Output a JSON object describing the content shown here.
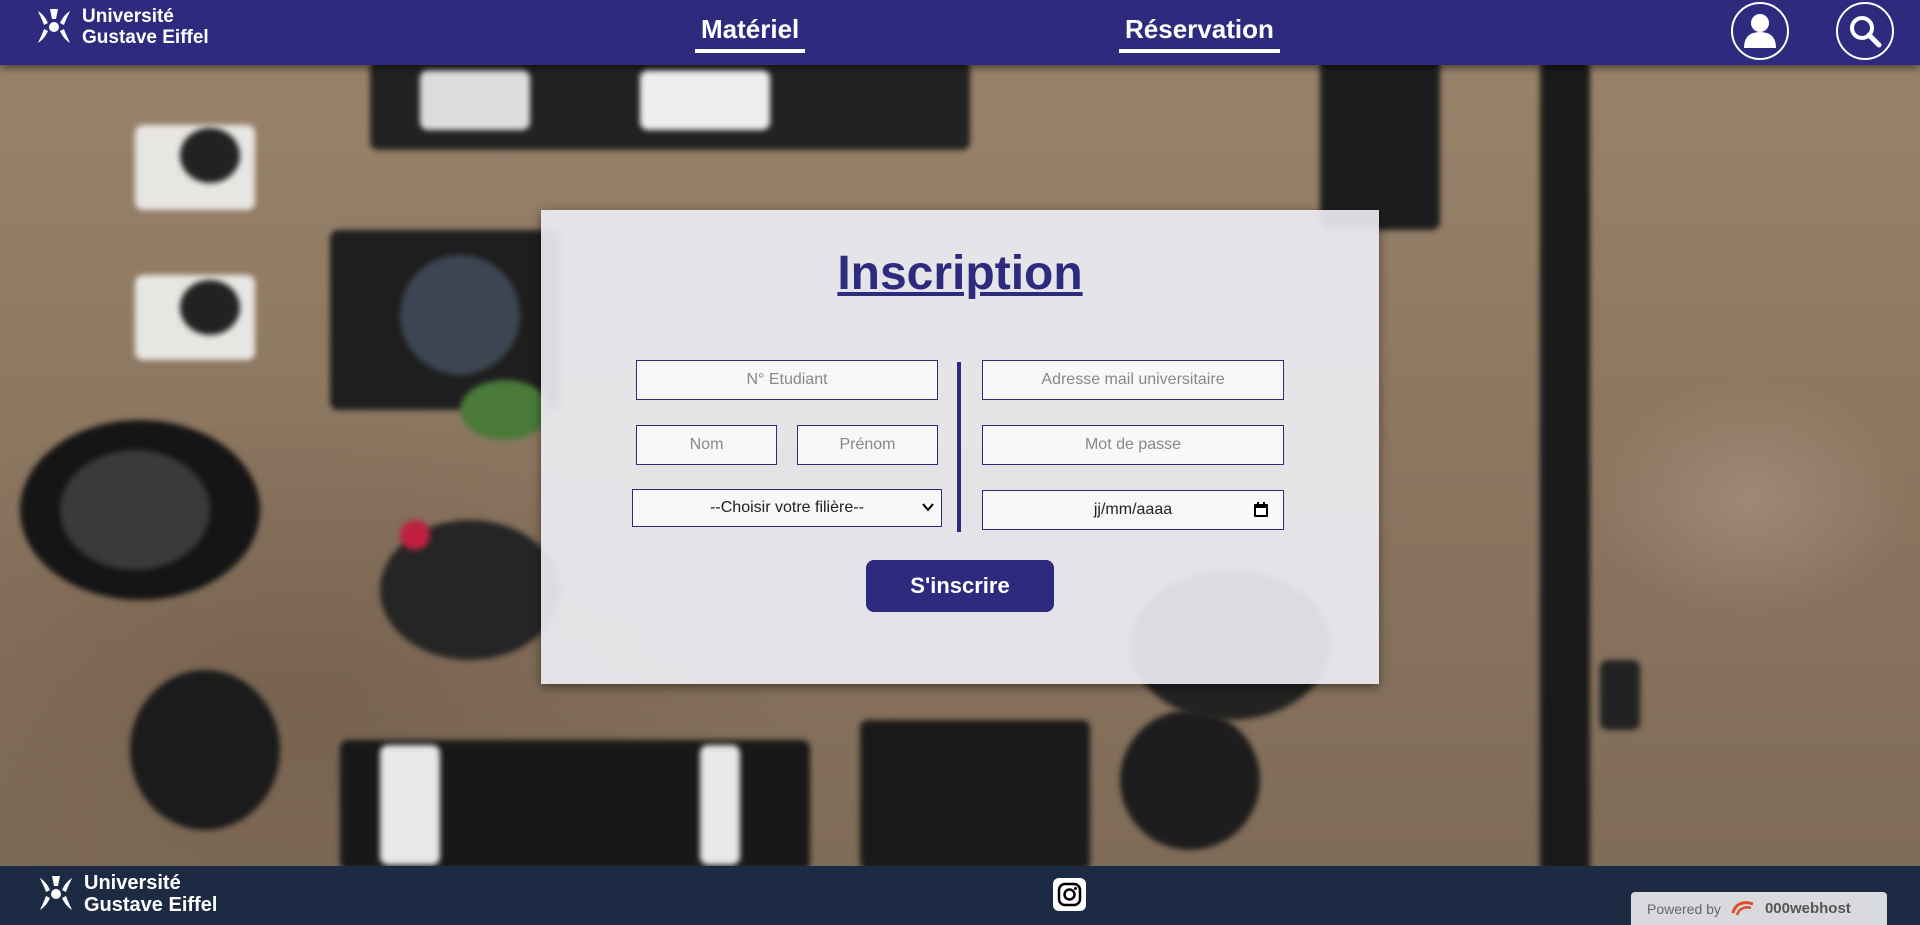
{
  "header": {
    "logo_line1": "Université",
    "logo_line2": "Gustave Eiffel",
    "nav": [
      {
        "label": "Matériel"
      },
      {
        "label": "Réservation"
      }
    ],
    "account_icon": "user-icon",
    "search_icon": "search-icon"
  },
  "form": {
    "title": "Inscription",
    "student_number_placeholder": "N° Etudiant",
    "last_name_placeholder": "Nom",
    "first_name_placeholder": "Prénom",
    "program_select_value": "--Choisir votre filière--",
    "email_placeholder": "Adresse mail universitaire",
    "password_placeholder": "Mot de passe",
    "date_placeholder": "jj/mm/aaaa",
    "submit_label": "S'inscrire"
  },
  "footer": {
    "logo_line1": "Université",
    "logo_line2": "Gustave Eiffel",
    "social_icon": "instagram-icon",
    "powered_by_label": "Powered by",
    "powered_by_brand": "000webhost"
  },
  "colors": {
    "primary": "#2e2a7e",
    "footer_bg": "#1c2a44",
    "panel_bg": "#f0f0f6"
  }
}
